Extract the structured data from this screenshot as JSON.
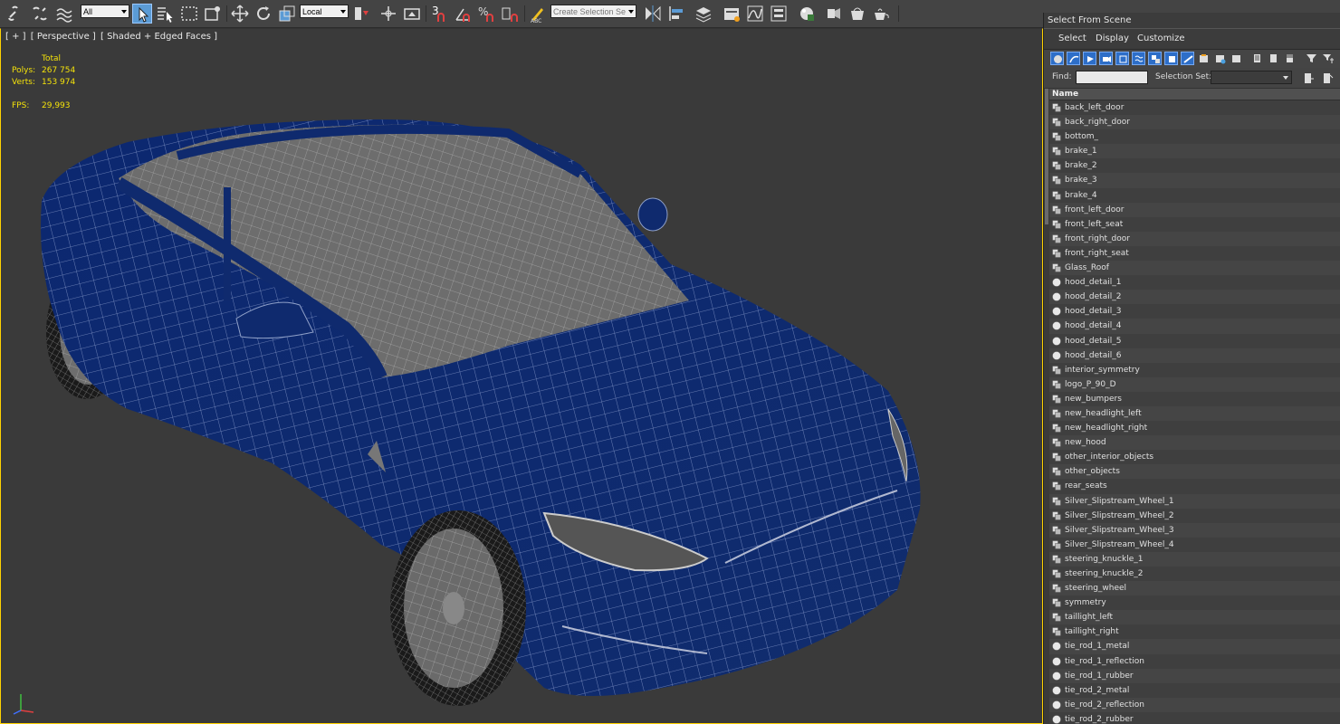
{
  "toolbar": {
    "selection_filter": "All",
    "coordinate_system": "Local",
    "snap_toggle_label": "3",
    "named_selection_set": "Create Selection Se"
  },
  "viewport": {
    "label_plus": "[ + ]",
    "label_view": "[ Perspective ]",
    "label_shading": "[ Shaded + Edged Faces ]",
    "stats": {
      "total_label": "Total",
      "polys_label": "Polys:",
      "polys_value": "267 754",
      "verts_label": "Verts:",
      "verts_value": "153 974",
      "fps_label": "FPS:",
      "fps_value": "29,993"
    },
    "model_colors": {
      "body": "#0f2a6e",
      "wire": "#8fa0c8",
      "interior": "#7a7a7a"
    }
  },
  "scene_explorer": {
    "title": "Select From Scene",
    "menu": [
      "Select",
      "Display",
      "Customize"
    ],
    "find_label": "Find:",
    "find_value": "",
    "selection_set_label": "Selection Set:",
    "selection_set_value": "",
    "column_header": "Name",
    "items": [
      {
        "name": "back_left_door",
        "icon": "editable-poly-icon"
      },
      {
        "name": "back_right_door",
        "icon": "editable-poly-icon"
      },
      {
        "name": "bottom_",
        "icon": "editable-poly-icon"
      },
      {
        "name": "brake_1",
        "icon": "editable-poly-icon"
      },
      {
        "name": "brake_2",
        "icon": "editable-poly-icon"
      },
      {
        "name": "brake_3",
        "icon": "editable-poly-icon"
      },
      {
        "name": "brake_4",
        "icon": "editable-poly-icon"
      },
      {
        "name": "front_left_door",
        "icon": "editable-poly-icon"
      },
      {
        "name": "front_left_seat",
        "icon": "editable-poly-icon"
      },
      {
        "name": "front_right_door",
        "icon": "editable-poly-icon"
      },
      {
        "name": "front_right_seat",
        "icon": "editable-poly-icon"
      },
      {
        "name": "Glass_Roof",
        "icon": "editable-poly-icon"
      },
      {
        "name": "hood_detail_1",
        "icon": "sphere-icon"
      },
      {
        "name": "hood_detail_2",
        "icon": "sphere-icon"
      },
      {
        "name": "hood_detail_3",
        "icon": "sphere-icon"
      },
      {
        "name": "hood_detail_4",
        "icon": "sphere-icon"
      },
      {
        "name": "hood_detail_5",
        "icon": "sphere-icon"
      },
      {
        "name": "hood_detail_6",
        "icon": "sphere-icon"
      },
      {
        "name": "interior_symmetry",
        "icon": "editable-poly-icon"
      },
      {
        "name": "logo_P_90_D",
        "icon": "editable-poly-icon"
      },
      {
        "name": "new_bumpers",
        "icon": "editable-poly-icon"
      },
      {
        "name": "new_headlight_left",
        "icon": "editable-poly-icon"
      },
      {
        "name": "new_headlight_right",
        "icon": "editable-poly-icon"
      },
      {
        "name": "new_hood",
        "icon": "editable-poly-icon"
      },
      {
        "name": "other_interior_objects",
        "icon": "editable-poly-icon"
      },
      {
        "name": "other_objects",
        "icon": "editable-poly-icon"
      },
      {
        "name": "rear_seats",
        "icon": "editable-poly-icon"
      },
      {
        "name": "Silver_Slipstream_Wheel_1",
        "icon": "editable-poly-icon"
      },
      {
        "name": "Silver_Slipstream_Wheel_2",
        "icon": "editable-poly-icon"
      },
      {
        "name": "Silver_Slipstream_Wheel_3",
        "icon": "editable-poly-icon"
      },
      {
        "name": "Silver_Slipstream_Wheel_4",
        "icon": "editable-poly-icon"
      },
      {
        "name": "steering_knuckle_1",
        "icon": "editable-poly-icon"
      },
      {
        "name": "steering_knuckle_2",
        "icon": "editable-poly-icon"
      },
      {
        "name": "steering_wheel",
        "icon": "editable-poly-icon"
      },
      {
        "name": "symmetry",
        "icon": "editable-poly-icon"
      },
      {
        "name": "taillight_left",
        "icon": "editable-poly-icon"
      },
      {
        "name": "taillight_right",
        "icon": "editable-poly-icon"
      },
      {
        "name": "tie_rod_1_metal",
        "icon": "sphere-icon"
      },
      {
        "name": "tie_rod_1_reflection",
        "icon": "sphere-icon"
      },
      {
        "name": "tie_rod_1_rubber",
        "icon": "sphere-icon"
      },
      {
        "name": "tie_rod_2_metal",
        "icon": "sphere-icon"
      },
      {
        "name": "tie_rod_2_reflection",
        "icon": "sphere-icon"
      },
      {
        "name": "tie_rod_2_rubber",
        "icon": "sphere-icon"
      }
    ]
  }
}
